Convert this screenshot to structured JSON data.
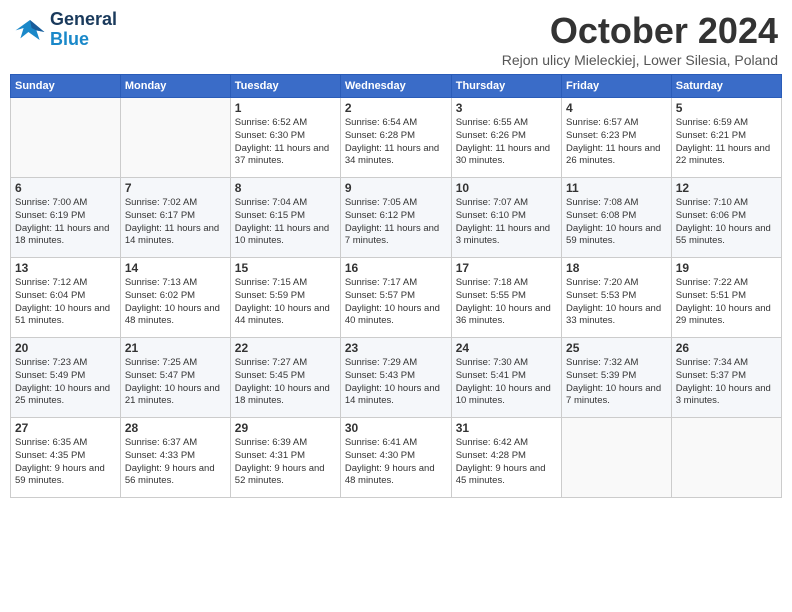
{
  "logo": {
    "line1": "General",
    "line2": "Blue"
  },
  "title": "October 2024",
  "subtitle": "Rejon ulicy Mieleckiej, Lower Silesia, Poland",
  "weekdays": [
    "Sunday",
    "Monday",
    "Tuesday",
    "Wednesday",
    "Thursday",
    "Friday",
    "Saturday"
  ],
  "weeks": [
    [
      {
        "day": "",
        "sunrise": "",
        "sunset": "",
        "daylight": ""
      },
      {
        "day": "",
        "sunrise": "",
        "sunset": "",
        "daylight": ""
      },
      {
        "day": "1",
        "sunrise": "Sunrise: 6:52 AM",
        "sunset": "Sunset: 6:30 PM",
        "daylight": "Daylight: 11 hours and 37 minutes."
      },
      {
        "day": "2",
        "sunrise": "Sunrise: 6:54 AM",
        "sunset": "Sunset: 6:28 PM",
        "daylight": "Daylight: 11 hours and 34 minutes."
      },
      {
        "day": "3",
        "sunrise": "Sunrise: 6:55 AM",
        "sunset": "Sunset: 6:26 PM",
        "daylight": "Daylight: 11 hours and 30 minutes."
      },
      {
        "day": "4",
        "sunrise": "Sunrise: 6:57 AM",
        "sunset": "Sunset: 6:23 PM",
        "daylight": "Daylight: 11 hours and 26 minutes."
      },
      {
        "day": "5",
        "sunrise": "Sunrise: 6:59 AM",
        "sunset": "Sunset: 6:21 PM",
        "daylight": "Daylight: 11 hours and 22 minutes."
      }
    ],
    [
      {
        "day": "6",
        "sunrise": "Sunrise: 7:00 AM",
        "sunset": "Sunset: 6:19 PM",
        "daylight": "Daylight: 11 hours and 18 minutes."
      },
      {
        "day": "7",
        "sunrise": "Sunrise: 7:02 AM",
        "sunset": "Sunset: 6:17 PM",
        "daylight": "Daylight: 11 hours and 14 minutes."
      },
      {
        "day": "8",
        "sunrise": "Sunrise: 7:04 AM",
        "sunset": "Sunset: 6:15 PM",
        "daylight": "Daylight: 11 hours and 10 minutes."
      },
      {
        "day": "9",
        "sunrise": "Sunrise: 7:05 AM",
        "sunset": "Sunset: 6:12 PM",
        "daylight": "Daylight: 11 hours and 7 minutes."
      },
      {
        "day": "10",
        "sunrise": "Sunrise: 7:07 AM",
        "sunset": "Sunset: 6:10 PM",
        "daylight": "Daylight: 11 hours and 3 minutes."
      },
      {
        "day": "11",
        "sunrise": "Sunrise: 7:08 AM",
        "sunset": "Sunset: 6:08 PM",
        "daylight": "Daylight: 10 hours and 59 minutes."
      },
      {
        "day": "12",
        "sunrise": "Sunrise: 7:10 AM",
        "sunset": "Sunset: 6:06 PM",
        "daylight": "Daylight: 10 hours and 55 minutes."
      }
    ],
    [
      {
        "day": "13",
        "sunrise": "Sunrise: 7:12 AM",
        "sunset": "Sunset: 6:04 PM",
        "daylight": "Daylight: 10 hours and 51 minutes."
      },
      {
        "day": "14",
        "sunrise": "Sunrise: 7:13 AM",
        "sunset": "Sunset: 6:02 PM",
        "daylight": "Daylight: 10 hours and 48 minutes."
      },
      {
        "day": "15",
        "sunrise": "Sunrise: 7:15 AM",
        "sunset": "Sunset: 5:59 PM",
        "daylight": "Daylight: 10 hours and 44 minutes."
      },
      {
        "day": "16",
        "sunrise": "Sunrise: 7:17 AM",
        "sunset": "Sunset: 5:57 PM",
        "daylight": "Daylight: 10 hours and 40 minutes."
      },
      {
        "day": "17",
        "sunrise": "Sunrise: 7:18 AM",
        "sunset": "Sunset: 5:55 PM",
        "daylight": "Daylight: 10 hours and 36 minutes."
      },
      {
        "day": "18",
        "sunrise": "Sunrise: 7:20 AM",
        "sunset": "Sunset: 5:53 PM",
        "daylight": "Daylight: 10 hours and 33 minutes."
      },
      {
        "day": "19",
        "sunrise": "Sunrise: 7:22 AM",
        "sunset": "Sunset: 5:51 PM",
        "daylight": "Daylight: 10 hours and 29 minutes."
      }
    ],
    [
      {
        "day": "20",
        "sunrise": "Sunrise: 7:23 AM",
        "sunset": "Sunset: 5:49 PM",
        "daylight": "Daylight: 10 hours and 25 minutes."
      },
      {
        "day": "21",
        "sunrise": "Sunrise: 7:25 AM",
        "sunset": "Sunset: 5:47 PM",
        "daylight": "Daylight: 10 hours and 21 minutes."
      },
      {
        "day": "22",
        "sunrise": "Sunrise: 7:27 AM",
        "sunset": "Sunset: 5:45 PM",
        "daylight": "Daylight: 10 hours and 18 minutes."
      },
      {
        "day": "23",
        "sunrise": "Sunrise: 7:29 AM",
        "sunset": "Sunset: 5:43 PM",
        "daylight": "Daylight: 10 hours and 14 minutes."
      },
      {
        "day": "24",
        "sunrise": "Sunrise: 7:30 AM",
        "sunset": "Sunset: 5:41 PM",
        "daylight": "Daylight: 10 hours and 10 minutes."
      },
      {
        "day": "25",
        "sunrise": "Sunrise: 7:32 AM",
        "sunset": "Sunset: 5:39 PM",
        "daylight": "Daylight: 10 hours and 7 minutes."
      },
      {
        "day": "26",
        "sunrise": "Sunrise: 7:34 AM",
        "sunset": "Sunset: 5:37 PM",
        "daylight": "Daylight: 10 hours and 3 minutes."
      }
    ],
    [
      {
        "day": "27",
        "sunrise": "Sunrise: 6:35 AM",
        "sunset": "Sunset: 4:35 PM",
        "daylight": "Daylight: 9 hours and 59 minutes."
      },
      {
        "day": "28",
        "sunrise": "Sunrise: 6:37 AM",
        "sunset": "Sunset: 4:33 PM",
        "daylight": "Daylight: 9 hours and 56 minutes."
      },
      {
        "day": "29",
        "sunrise": "Sunrise: 6:39 AM",
        "sunset": "Sunset: 4:31 PM",
        "daylight": "Daylight: 9 hours and 52 minutes."
      },
      {
        "day": "30",
        "sunrise": "Sunrise: 6:41 AM",
        "sunset": "Sunset: 4:30 PM",
        "daylight": "Daylight: 9 hours and 48 minutes."
      },
      {
        "day": "31",
        "sunrise": "Sunrise: 6:42 AM",
        "sunset": "Sunset: 4:28 PM",
        "daylight": "Daylight: 9 hours and 45 minutes."
      },
      {
        "day": "",
        "sunrise": "",
        "sunset": "",
        "daylight": ""
      },
      {
        "day": "",
        "sunrise": "",
        "sunset": "",
        "daylight": ""
      }
    ]
  ]
}
